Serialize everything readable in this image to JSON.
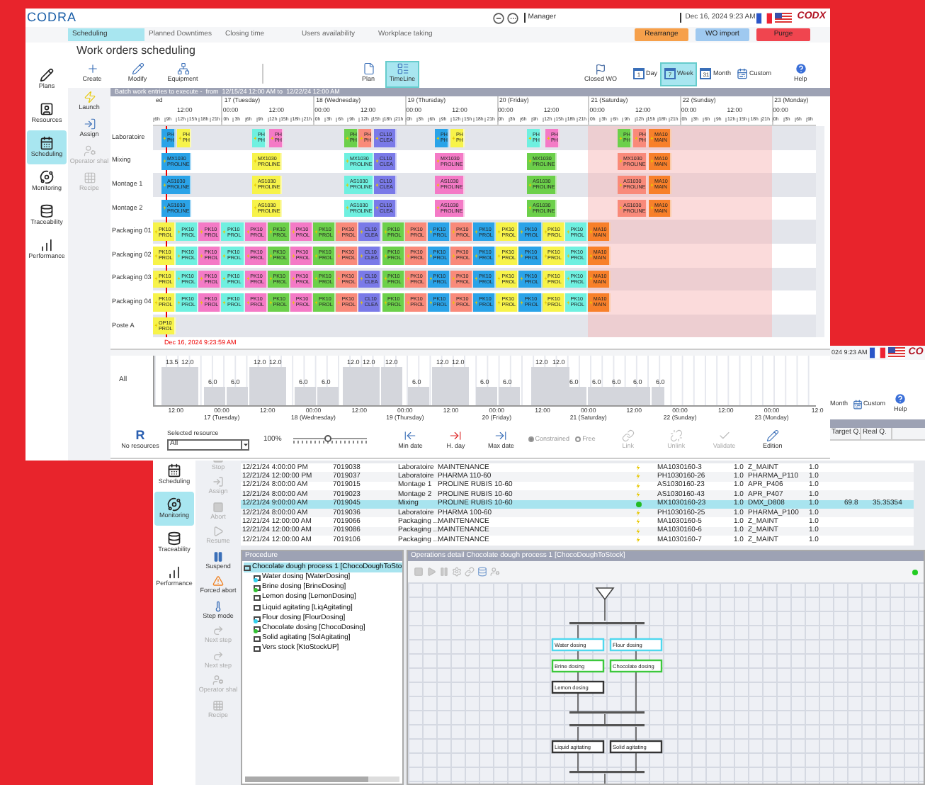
{
  "front_window": {
    "logo": "CODRA",
    "user": "Manager",
    "datetime": "Dec 16, 2024 9:23 AM",
    "brand": "CODX",
    "tabs": [
      {
        "label": "Scheduling",
        "selected": true
      },
      {
        "label": "Planned Downtimes",
        "selected": false
      },
      {
        "label": "Closing time",
        "selected": false
      },
      {
        "label": "Users availability",
        "selected": false
      },
      {
        "label": "Workplace taking",
        "selected": false
      }
    ],
    "actions": [
      {
        "label": "Rearrange",
        "kind": "rearrange"
      },
      {
        "label": "WO import",
        "kind": "import"
      },
      {
        "label": "Purge",
        "kind": "purge"
      }
    ],
    "sidebar": [
      {
        "label": "Plans",
        "kind": "plans",
        "selected": false
      },
      {
        "label": "Resources",
        "kind": "resources",
        "selected": false
      },
      {
        "label": "Scheduling",
        "kind": "scheduling",
        "selected": true
      },
      {
        "label": "Monitoring",
        "kind": "monitoring",
        "selected": false
      },
      {
        "label": "Traceability",
        "kind": "traceability",
        "selected": false
      },
      {
        "label": "Performance",
        "kind": "performance",
        "selected": false
      }
    ],
    "title": "Work orders scheduling",
    "edit_tools": [
      {
        "label": "Create",
        "kind": "create"
      },
      {
        "label": "Modify",
        "kind": "modify"
      },
      {
        "label": "Equipment",
        "kind": "equipment"
      }
    ],
    "views": [
      {
        "label": "Plan",
        "kind": "plan",
        "selected": false
      },
      {
        "label": "TimeLine",
        "kind": "timeline",
        "selected": true
      }
    ],
    "closed_wo": "Closed WO",
    "periods": [
      {
        "label": "Day",
        "icon_text": "1",
        "selected": false
      },
      {
        "label": "Week",
        "icon_text": "7",
        "selected": true
      },
      {
        "label": "Month",
        "icon_text": "31",
        "selected": false
      },
      {
        "label": "Custom",
        "selected": false
      }
    ],
    "help": "Help",
    "tools": [
      {
        "label": "Launch",
        "kind": "launch",
        "disabled": false
      },
      {
        "label": "Assign",
        "kind": "assign",
        "disabled": false
      },
      {
        "label": "Operator shal",
        "kind": "operator",
        "disabled": true
      },
      {
        "label": "Recipe",
        "kind": "recipe",
        "disabled": true
      }
    ],
    "gantt": {
      "caption": "Batch work entries to execute -  from  12/15/24 12:00 AM to  12/22/24 12:00 AM",
      "days": [
        {
          "label": "ed",
          "halves": [
            "12:00"
          ],
          "hours": [
            "6h",
            "9h",
            "12h",
            "15h",
            "18h",
            "21h"
          ]
        },
        {
          "label": "17 (Tuesday)",
          "halves": [
            "00:00",
            "12:00"
          ],
          "hours": [
            "0h",
            "3h",
            "6h",
            "9h",
            "12h",
            "15h",
            "18h",
            "21h"
          ]
        },
        {
          "label": "18 (Wednesday)",
          "halves": [
            "00:00",
            "12:00"
          ],
          "hours": [
            "0h",
            "3h",
            "6h",
            "9h",
            "12h",
            "15h",
            "18h",
            "21h"
          ]
        },
        {
          "label": "19 (Thursday)",
          "halves": [
            "00:00",
            "12:00"
          ],
          "hours": [
            "0h",
            "3h",
            "6h",
            "9h",
            "12h",
            "15h",
            "18h",
            "21h"
          ]
        },
        {
          "label": "20 (Friday)",
          "halves": [
            "00:00",
            "12:00"
          ],
          "hours": [
            "0h",
            "3h",
            "6h",
            "9h",
            "12h",
            "15h",
            "18h",
            "21h"
          ]
        },
        {
          "label": "21 (Saturday)",
          "halves": [
            "00:00",
            "12:00"
          ],
          "hours": [
            "0h",
            "3h",
            "6h",
            "9h",
            "12h",
            "15h",
            "18h",
            "21h"
          ]
        },
        {
          "label": "22 (Sunday)",
          "halves": [
            "00:00",
            "12:00"
          ],
          "hours": [
            "0h",
            "3h",
            "6h",
            "9h",
            "12h",
            "15h",
            "18h",
            "21h"
          ]
        },
        {
          "label": "23 (Monday)",
          "halves": [
            "00:00"
          ],
          "hours": [
            "0h",
            "3h",
            "6h",
            "9h"
          ]
        }
      ],
      "rows": [
        {
          "resource": "Laboratoire",
          "kind": "line",
          "blocks": [
            {
              "code": "PH",
              "name": "PH",
              "color": "#2aa3e8"
            },
            {
              "code": "PH",
              "name": "PH",
              "color": "#f7f34a"
            },
            {
              "code": "PH",
              "name": "PH",
              "color": "#6ff0e0"
            },
            {
              "code": "PH",
              "name": "PH",
              "color": "#f47ac6"
            },
            {
              "code": "PH",
              "name": "PH",
              "color": "#6cd04a"
            },
            {
              "code": "PH",
              "name": "PH",
              "color": "#f98a7a"
            },
            {
              "code": "CL10",
              "name": "CLEA",
              "color": "#7a7ae8"
            },
            {
              "code": "PH",
              "name": "PH",
              "color": "#2aa3e8"
            },
            {
              "code": "PH",
              "name": "PH",
              "color": "#f7f34a"
            },
            {
              "code": "PH",
              "name": "PH",
              "color": "#6ff0e0"
            },
            {
              "code": "PH",
              "name": "PH",
              "color": "#f47ac6"
            },
            {
              "code": "PH",
              "name": "PH",
              "color": "#6cd04a"
            },
            {
              "code": "PH",
              "name": "PH",
              "color": "#f98a7a"
            },
            {
              "code": "MA10",
              "name": "MAIN",
              "color": "#f8802a"
            }
          ]
        },
        {
          "resource": "Mixing",
          "kind": "line",
          "blocks": [
            {
              "code": "MX1030",
              "name": "PROLINE",
              "color": "#2aa3e8"
            },
            {
              "code": "MX1030",
              "name": "PROLINE",
              "color": "#f7f34a"
            },
            {
              "code": "MX1030",
              "name": "PROLINE",
              "color": "#6ff0e0"
            },
            {
              "code": "CL10",
              "name": "CLEA",
              "color": "#7a7ae8"
            },
            {
              "code": "MX1030",
              "name": "PROLINE",
              "color": "#f47ac6"
            },
            {
              "code": "MX1030",
              "name": "PROLINE",
              "color": "#6cd04a"
            },
            {
              "code": "MX1030",
              "name": "PROLINE",
              "color": "#f98a7a"
            },
            {
              "code": "MA10",
              "name": "MAIN",
              "color": "#f8802a"
            }
          ]
        },
        {
          "resource": "Montage 1",
          "kind": "line",
          "blocks": [
            {
              "code": "AS1030",
              "name": "PROLINE",
              "color": "#2aa3e8"
            },
            {
              "code": "AS1030",
              "name": "PROLINE",
              "color": "#f7f34a"
            },
            {
              "code": "AS1030",
              "name": "PROLINE",
              "color": "#6ff0e0"
            },
            {
              "code": "CL10",
              "name": "CLEA",
              "color": "#7a7ae8"
            },
            {
              "code": "AS1030",
              "name": "PROLINE",
              "color": "#f47ac6"
            },
            {
              "code": "AS1030",
              "name": "PROLINE",
              "color": "#6cd04a"
            },
            {
              "code": "AS1030",
              "name": "PROLINE",
              "color": "#f98a7a"
            },
            {
              "code": "MA10",
              "name": "MAIN",
              "color": "#f8802a"
            }
          ]
        },
        {
          "resource": "Montage 2",
          "kind": "line",
          "blocks": [
            {
              "code": "AS1030",
              "name": "PROLINE",
              "color": "#2aa3e8"
            },
            {
              "code": "AS1030",
              "name": "PROLINE",
              "color": "#f7f34a"
            },
            {
              "code": "AS1030",
              "name": "PROLINE",
              "color": "#6ff0e0"
            },
            {
              "code": "CL10",
              "name": "CLEA",
              "color": "#7a7ae8"
            },
            {
              "code": "AS1030",
              "name": "PROLINE",
              "color": "#f47ac6"
            },
            {
              "code": "AS1030",
              "name": "PROLINE",
              "color": "#6cd04a"
            },
            {
              "code": "AS1030",
              "name": "PROLINE",
              "color": "#f98a7a"
            },
            {
              "code": "MA10",
              "name": "MAIN",
              "color": "#f8802a"
            }
          ]
        },
        {
          "resource": "Packaging 01",
          "kind": "packaging",
          "blocks": [
            {
              "code": "PK10",
              "name": "PROL",
              "color": "#f7f34a"
            },
            {
              "code": "PK10",
              "name": "PROL",
              "color": "#6ff0e0"
            },
            {
              "code": "PK10",
              "name": "PROL",
              "color": "#f47ac6"
            },
            {
              "code": "PK10",
              "name": "PROL",
              "color": "#6ff0e0"
            },
            {
              "code": "PK10",
              "name": "PROL",
              "color": "#f47ac6"
            },
            {
              "code": "PK10",
              "name": "PROL",
              "color": "#6cd04a"
            },
            {
              "code": "PK10",
              "name": "PROL",
              "color": "#f47ac6"
            },
            {
              "code": "PK10",
              "name": "PROL",
              "color": "#6cd04a"
            },
            {
              "code": "PK10",
              "name": "PROL",
              "color": "#f98a7a"
            },
            {
              "code": "CL10",
              "name": "CLEA",
              "color": "#7a7ae8"
            },
            {
              "code": "PK10",
              "name": "PROL",
              "color": "#6cd04a"
            },
            {
              "code": "PK10",
              "name": "PROL",
              "color": "#f98a7a"
            },
            {
              "code": "PK10",
              "name": "PROL",
              "color": "#2aa3e8"
            },
            {
              "code": "PK10",
              "name": "PROL",
              "color": "#f98a7a"
            },
            {
              "code": "PK10",
              "name": "PROL",
              "color": "#2aa3e8"
            },
            {
              "code": "PK10",
              "name": "PROL",
              "color": "#f7f34a"
            },
            {
              "code": "PK10",
              "name": "PROL",
              "color": "#2aa3e8"
            },
            {
              "code": "PK10",
              "name": "PROL",
              "color": "#f7f34a"
            },
            {
              "code": "PK10",
              "name": "PROL",
              "color": "#6ff0e0"
            },
            {
              "code": "MA10",
              "name": "MAIN",
              "color": "#f8802a"
            }
          ]
        },
        {
          "resource": "Packaging 02",
          "kind": "packaging",
          "blocks": [
            {
              "code": "PK10",
              "name": "PROL",
              "color": "#f7f34a"
            },
            {
              "code": "PK10",
              "name": "PROL",
              "color": "#6ff0e0"
            },
            {
              "code": "PK10",
              "name": "PROL",
              "color": "#f47ac6"
            },
            {
              "code": "PK10",
              "name": "PROL",
              "color": "#6ff0e0"
            },
            {
              "code": "PK10",
              "name": "PROL",
              "color": "#f47ac6"
            },
            {
              "code": "PK10",
              "name": "PROL",
              "color": "#6cd04a"
            },
            {
              "code": "PK10",
              "name": "PROL",
              "color": "#f47ac6"
            },
            {
              "code": "PK10",
              "name": "PROL",
              "color": "#6cd04a"
            },
            {
              "code": "PK10",
              "name": "PROL",
              "color": "#f98a7a"
            },
            {
              "code": "CL10",
              "name": "CLEA",
              "color": "#7a7ae8"
            },
            {
              "code": "PK10",
              "name": "PROL",
              "color": "#6cd04a"
            },
            {
              "code": "PK10",
              "name": "PROL",
              "color": "#f98a7a"
            },
            {
              "code": "PK10",
              "name": "PROL",
              "color": "#2aa3e8"
            },
            {
              "code": "PK10",
              "name": "PROL",
              "color": "#f98a7a"
            },
            {
              "code": "PK10",
              "name": "PROL",
              "color": "#2aa3e8"
            },
            {
              "code": "PK10",
              "name": "PROL",
              "color": "#f7f34a"
            },
            {
              "code": "PK10",
              "name": "PROL",
              "color": "#2aa3e8"
            },
            {
              "code": "PK10",
              "name": "PROL",
              "color": "#f7f34a"
            },
            {
              "code": "PK10",
              "name": "PROL",
              "color": "#6ff0e0"
            },
            {
              "code": "MA10",
              "name": "MAIN",
              "color": "#f8802a"
            }
          ]
        },
        {
          "resource": "Packaging 03",
          "kind": "packaging",
          "blocks": [
            {
              "code": "PK10",
              "name": "PROL",
              "color": "#f7f34a"
            },
            {
              "code": "PK10",
              "name": "PROL",
              "color": "#6ff0e0"
            },
            {
              "code": "PK10",
              "name": "PROL",
              "color": "#f47ac6"
            },
            {
              "code": "PK10",
              "name": "PROL",
              "color": "#6ff0e0"
            },
            {
              "code": "PK10",
              "name": "PROL",
              "color": "#f47ac6"
            },
            {
              "code": "PK10",
              "name": "PROL",
              "color": "#6cd04a"
            },
            {
              "code": "PK10",
              "name": "PROL",
              "color": "#f47ac6"
            },
            {
              "code": "PK10",
              "name": "PROL",
              "color": "#6cd04a"
            },
            {
              "code": "PK10",
              "name": "PROL",
              "color": "#f98a7a"
            },
            {
              "code": "CL10",
              "name": "CLEA",
              "color": "#7a7ae8"
            },
            {
              "code": "PK10",
              "name": "PROL",
              "color": "#6cd04a"
            },
            {
              "code": "PK10",
              "name": "PROL",
              "color": "#f98a7a"
            },
            {
              "code": "PK10",
              "name": "PROL",
              "color": "#2aa3e8"
            },
            {
              "code": "PK10",
              "name": "PROL",
              "color": "#f98a7a"
            },
            {
              "code": "PK10",
              "name": "PROL",
              "color": "#2aa3e8"
            },
            {
              "code": "PK10",
              "name": "PROL",
              "color": "#f7f34a"
            },
            {
              "code": "PK10",
              "name": "PROL",
              "color": "#2aa3e8"
            },
            {
              "code": "PK10",
              "name": "PROL",
              "color": "#f7f34a"
            },
            {
              "code": "PK10",
              "name": "PROL",
              "color": "#6ff0e0"
            },
            {
              "code": "MA10",
              "name": "MAIN",
              "color": "#f8802a"
            }
          ]
        },
        {
          "resource": "Packaging 04",
          "kind": "packaging",
          "blocks": [
            {
              "code": "PK10",
              "name": "PROL",
              "color": "#f7f34a"
            },
            {
              "code": "PK10",
              "name": "PROL",
              "color": "#6ff0e0"
            },
            {
              "code": "PK10",
              "name": "PROL",
              "color": "#f47ac6"
            },
            {
              "code": "PK10",
              "name": "PROL",
              "color": "#6ff0e0"
            },
            {
              "code": "PK10",
              "name": "PROL",
              "color": "#f47ac6"
            },
            {
              "code": "PK10",
              "name": "PROL",
              "color": "#6cd04a"
            },
            {
              "code": "PK10",
              "name": "PROL",
              "color": "#f47ac6"
            },
            {
              "code": "PK10",
              "name": "PROL",
              "color": "#6cd04a"
            },
            {
              "code": "PK10",
              "name": "PROL",
              "color": "#f98a7a"
            },
            {
              "code": "CL10",
              "name": "CLEA",
              "color": "#7a7ae8"
            },
            {
              "code": "PK10",
              "name": "PROL",
              "color": "#6cd04a"
            },
            {
              "code": "PK10",
              "name": "PROL",
              "color": "#f98a7a"
            },
            {
              "code": "PK10",
              "name": "PROL",
              "color": "#2aa3e8"
            },
            {
              "code": "PK10",
              "name": "PROL",
              "color": "#f98a7a"
            },
            {
              "code": "PK10",
              "name": "PROL",
              "color": "#2aa3e8"
            },
            {
              "code": "PK10",
              "name": "PROL",
              "color": "#f7f34a"
            },
            {
              "code": "PK10",
              "name": "PROL",
              "color": "#2aa3e8"
            },
            {
              "code": "PK10",
              "name": "PROL",
              "color": "#f7f34a"
            },
            {
              "code": "PK10",
              "name": "PROL",
              "color": "#6ff0e0"
            },
            {
              "code": "MA10",
              "name": "MAIN",
              "color": "#f8802a"
            }
          ]
        },
        {
          "resource": "Poste A",
          "kind": "packaging",
          "blocks": [
            {
              "code": "OP10",
              "name": "PROL",
              "color": "#f7f34a"
            }
          ]
        }
      ],
      "now": "Dec 16, 2024 9:23:59 AM"
    },
    "load": {
      "label": "All",
      "values": [
        {
          "value": "13.5",
          "kind": "high"
        },
        {
          "value": "12.0",
          "kind": "high"
        },
        {
          "value": "6.0",
          "kind": "low"
        },
        {
          "value": "6.0",
          "kind": "low"
        },
        {
          "value": "12.0",
          "kind": "high"
        },
        {
          "value": "12.0",
          "kind": "high"
        },
        {
          "value": "6.0",
          "kind": "low"
        },
        {
          "value": "6.0",
          "kind": "low"
        },
        {
          "value": "12.0",
          "kind": "high"
        },
        {
          "value": "12.0",
          "kind": "high"
        },
        {
          "value": "12.0",
          "kind": "high"
        },
        {
          "value": "6.0",
          "kind": "low"
        },
        {
          "value": "12.0",
          "kind": "high"
        },
        {
          "value": "12.0",
          "kind": "high"
        },
        {
          "value": "6.0",
          "kind": "low"
        },
        {
          "value": "6.0",
          "kind": "low"
        },
        {
          "value": "12.0",
          "kind": "high"
        },
        {
          "value": "12.0",
          "kind": "high"
        },
        {
          "value": "6.0",
          "kind": "low"
        },
        {
          "value": "6.0",
          "kind": "low"
        },
        {
          "value": "6.0",
          "kind": "low"
        },
        {
          "value": "6.0",
          "kind": "low"
        },
        {
          "value": "6.0",
          "kind": "low"
        }
      ],
      "axis": [
        {
          "time": "12:00"
        },
        {
          "time": "00:00",
          "day": "17 (Tuesday)"
        },
        {
          "time": "12:00"
        },
        {
          "time": "00:00",
          "day": "18 (Wednesday)"
        },
        {
          "time": "12:00"
        },
        {
          "time": "00:00",
          "day": "19 (Thursday)"
        },
        {
          "time": "12:00"
        },
        {
          "time": "00:00",
          "day": "20 (Friday)"
        },
        {
          "time": "12:00"
        },
        {
          "time": "00:00",
          "day": "21 (Saturday)"
        },
        {
          "time": "12:00"
        },
        {
          "time": "00:00",
          "day": "22 (Sunday)"
        },
        {
          "time": "12:00"
        },
        {
          "time": "00:00",
          "day": "23 (Monday)"
        },
        {
          "time": "12:0"
        }
      ]
    },
    "bottom": {
      "resources_icon": "R",
      "resources": "No resources",
      "selected_label": "Selected resource",
      "selected_value": "All",
      "zoom": "100%",
      "zoom_slider": {
        "level": 0.47
      },
      "nav": [
        {
          "label": "Min date",
          "kind": "min"
        },
        {
          "label": "H. day",
          "kind": "today"
        },
        {
          "label": "Max date",
          "kind": "max"
        }
      ],
      "modes": [
        {
          "label": "Constrained",
          "selected": true
        },
        {
          "label": "Free",
          "selected": false
        }
      ],
      "edits": [
        {
          "label": "Link",
          "kind": "link",
          "disabled": true
        },
        {
          "label": "Unlink",
          "kind": "unlink",
          "disabled": true
        },
        {
          "label": "Validate",
          "kind": "validate",
          "disabled": true
        },
        {
          "label": "Edition",
          "kind": "edition",
          "disabled": false
        }
      ]
    }
  },
  "back_window": {
    "datetime": "024 9:23 AM",
    "brand": "CO",
    "periods": [
      {
        "label": "Month"
      },
      {
        "label": "Custom"
      }
    ],
    "help": "Help",
    "columns": [
      "Target Q.",
      "Real Q."
    ],
    "sidebar": [
      {
        "label": "Scheduling",
        "kind": "scheduling",
        "selected": false
      },
      {
        "label": "Monitoring",
        "kind": "monitoring",
        "selected": true
      },
      {
        "label": "Traceability",
        "kind": "traceability",
        "selected": false
      },
      {
        "label": "Performance",
        "kind": "performance",
        "selected": false
      }
    ],
    "tools": [
      {
        "label": "Stop",
        "kind": "stop",
        "disabled": true
      },
      {
        "label": "Assign",
        "kind": "assign",
        "disabled": true
      },
      {
        "label": "Abort",
        "kind": "abort",
        "disabled": true
      },
      {
        "label": "Resume",
        "kind": "resume",
        "disabled": true
      },
      {
        "label": "Suspend",
        "kind": "suspend",
        "disabled": false
      },
      {
        "label": "Forced abort",
        "kind": "forced",
        "disabled": false
      },
      {
        "label": "Step mode",
        "kind": "step",
        "disabled": false
      },
      {
        "label": "Next step",
        "kind": "next",
        "disabled": true
      },
      {
        "label": "Next step",
        "kind": "next2",
        "disabled": true
      },
      {
        "label": "Operator shal",
        "kind": "operator",
        "disabled": true
      },
      {
        "label": "Recipe",
        "kind": "recipe",
        "disabled": true
      }
    ],
    "table": {
      "rows": [
        {
          "date": "12/21/24 4:00:00 PM",
          "order": "7019038",
          "resource": "Laboratoire",
          "product": "MAINTENANCE",
          "kind": "waiting",
          "code": "MA1030160-3",
          "qty": "1.0",
          "recipe": "Z_MAINT",
          "qty2": "1.0",
          "selected": false
        },
        {
          "date": "12/21/24 12:00:00 PM",
          "order": "7019037",
          "resource": "Laboratoire",
          "product": "PHARMA 110-60",
          "kind": "waiting",
          "code": "PH1030160-26",
          "qty": "1.0",
          "recipe": "PHARMA_P110",
          "qty2": "1.0",
          "selected": false
        },
        {
          "date": "12/21/24 8:00:00 AM",
          "order": "7019015",
          "resource": "Montage 1",
          "product": "PROLINE RUBIS 10-60",
          "kind": "waiting",
          "code": "AS1030160-23",
          "qty": "1.0",
          "recipe": "APR_P406",
          "qty2": "1.0",
          "selected": false
        },
        {
          "date": "12/21/24 8:00:00 AM",
          "order": "7019023",
          "resource": "Montage 2",
          "product": "PROLINE RUBIS 10-60",
          "kind": "waiting",
          "code": "AS1030160-43",
          "qty": "1.0",
          "recipe": "APR_P407",
          "qty2": "1.0",
          "selected": false
        },
        {
          "date": "12/21/24 9:00:00 AM",
          "order": "7019045",
          "resource": "Mixing",
          "product": "PROLINE RUBIS 10-60",
          "kind": "running",
          "code": "MX1030160-23",
          "qty": "1.0",
          "recipe": "DMX_D808",
          "qty2": "1.0",
          "target": "69.8",
          "real": "35.35354",
          "selected": true
        },
        {
          "date": "12/21/24 8:00:00 AM",
          "order": "7019036",
          "resource": "Laboratoire",
          "product": "PHARMA 100-60",
          "kind": "waiting",
          "code": "PH1030160-25",
          "qty": "1.0",
          "recipe": "PHARMA_P100",
          "qty2": "1.0",
          "selected": false
        },
        {
          "date": "12/21/24 12:00:00 AM",
          "order": "7019066",
          "resource": "Packaging ...",
          "product": "MAINTENANCE",
          "kind": "waiting",
          "code": "MA1030160-5",
          "qty": "1.0",
          "recipe": "Z_MAINT",
          "qty2": "1.0",
          "selected": false
        },
        {
          "date": "12/21/24 12:00:00 AM",
          "order": "7019086",
          "resource": "Packaging ...",
          "product": "MAINTENANCE",
          "kind": "waiting",
          "code": "MA1030160-6",
          "qty": "1.0",
          "recipe": "Z_MAINT",
          "qty2": "1.0",
          "selected": false
        },
        {
          "date": "12/21/24 12:00:00 AM",
          "order": "7019106",
          "resource": "Packaging ...",
          "product": "MAINTENANCE",
          "kind": "waiting",
          "code": "MA1030160-7",
          "qty": "1.0",
          "recipe": "Z_MAINT",
          "qty2": "1.0",
          "selected": false
        }
      ]
    },
    "procedure": {
      "title": "Procedure",
      "tree": [
        {
          "label": "Chocolate dough process 1 [ChocoDoughToSto",
          "selected": true,
          "children": [
            {
              "label": "Water dosing [WaterDosing]",
              "selected": false,
              "color": "#33d0ee"
            },
            {
              "label": "Brine dosing [BrineDosing]",
              "selected": false,
              "color": "#33c233"
            },
            {
              "label": "Lemon dosing  [LemonDosing]",
              "selected": false
            },
            {
              "label": "Liquid agitating [LiqAgitating]",
              "selected": false
            },
            {
              "label": "Flour dosing [FlourDosing]",
              "selected": false,
              "color": "#33d0ee"
            },
            {
              "label": "Chocolate dosing [ChocoDosing]",
              "selected": false,
              "color": "#33c233"
            },
            {
              "label": "Solid agitating [SolAgitating]",
              "selected": false
            },
            {
              "label": "Vers stock [KtoStockUP]",
              "selected": false
            }
          ]
        }
      ]
    },
    "operations": {
      "title": "Operations detail Chocolate dough process 1 [ChocoDoughToStock]",
      "running": true,
      "steps": [
        {
          "label": "Water dosing",
          "color": "#4fd8ee"
        },
        {
          "label": "Flour dosing",
          "color": "#4fd8ee"
        },
        {
          "label": "Brine dosing",
          "color": "#3cc83c"
        },
        {
          "label": "Chocolate dosing",
          "color": "#3cc83c"
        },
        {
          "label": "Lemon dosing",
          "color": "#333333"
        },
        {
          "label": "Liquid agitating",
          "color": "#333333"
        },
        {
          "label": "Solid agitating",
          "color": "#333333"
        }
      ]
    }
  }
}
